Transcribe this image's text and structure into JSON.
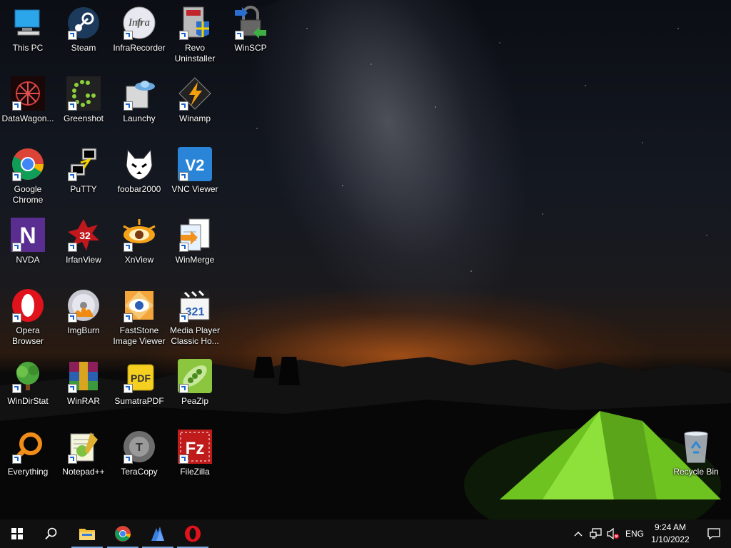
{
  "desktop_icons": [
    {
      "id": "this-pc",
      "label": "This PC",
      "icon": "computer-icon"
    },
    {
      "id": "steam",
      "label": "Steam",
      "icon": "steam-icon"
    },
    {
      "id": "infrarecorder",
      "label": "InfraRecorder",
      "icon": "infrarecorder-icon",
      "icon_text": "Infra"
    },
    {
      "id": "revo",
      "label": "Revo\nUninstaller",
      "icon": "revo-uninstaller-icon"
    },
    {
      "id": "winscp",
      "label": "WinSCP",
      "icon": "winscp-icon"
    },
    {
      "id": "datawagon",
      "label": "DataWagon...",
      "icon": "datawagon-icon"
    },
    {
      "id": "greenshot",
      "label": "Greenshot",
      "icon": "greenshot-icon"
    },
    {
      "id": "launchy",
      "label": "Launchy",
      "icon": "launchy-icon"
    },
    {
      "id": "winamp",
      "label": "Winamp",
      "icon": "winamp-icon"
    },
    {
      "id": "chrome",
      "label": "Google\nChrome",
      "icon": "chrome-icon"
    },
    {
      "id": "putty",
      "label": "PuTTY",
      "icon": "putty-icon"
    },
    {
      "id": "foobar",
      "label": "foobar2000",
      "icon": "foobar-icon"
    },
    {
      "id": "vnc",
      "label": "VNC Viewer",
      "icon": "vnc-icon",
      "icon_text": "V2"
    },
    {
      "id": "nvda",
      "label": "NVDA",
      "icon": "nvda-icon",
      "icon_text": "N"
    },
    {
      "id": "irfanview",
      "label": "IrfanView",
      "icon": "irfanview-icon",
      "icon_text": "32"
    },
    {
      "id": "xnview",
      "label": "XnView",
      "icon": "xnview-icon"
    },
    {
      "id": "winmerge",
      "label": "WinMerge",
      "icon": "winmerge-icon"
    },
    {
      "id": "opera",
      "label": "Opera\nBrowser",
      "icon": "opera-icon"
    },
    {
      "id": "imgburn",
      "label": "ImgBurn",
      "icon": "imgburn-icon"
    },
    {
      "id": "faststone",
      "label": "FastStone\nImage Viewer",
      "icon": "faststone-icon"
    },
    {
      "id": "mpc",
      "label": "Media Player\nClassic Ho...",
      "icon": "mpc-icon",
      "icon_text": "321"
    },
    {
      "id": "windirstat",
      "label": "WinDirStat",
      "icon": "windirstat-icon"
    },
    {
      "id": "winrar",
      "label": "WinRAR",
      "icon": "winrar-icon"
    },
    {
      "id": "sumatra",
      "label": "SumatraPDF",
      "icon": "sumatrapdf-icon",
      "icon_text": "PDF"
    },
    {
      "id": "peazip",
      "label": "PeaZip",
      "icon": "peazip-icon"
    },
    {
      "id": "everything",
      "label": "Everything",
      "icon": "everything-icon"
    },
    {
      "id": "notepadpp",
      "label": "Notepad++",
      "icon": "notepadpp-icon"
    },
    {
      "id": "teracopy",
      "label": "TeraCopy",
      "icon": "teracopy-icon",
      "icon_text": "T"
    },
    {
      "id": "filezilla",
      "label": "FileZilla",
      "icon": "filezilla-icon",
      "icon_text": "Fz"
    }
  ],
  "recycle_bin": {
    "label": "Recycle Bin",
    "icon": "recycle-bin-icon"
  },
  "taskbar": {
    "pinned": [
      {
        "id": "file-explorer",
        "icon": "folder-icon"
      },
      {
        "id": "chrome",
        "icon": "chrome-icon"
      },
      {
        "id": "app-blue",
        "icon": "blue-app-icon"
      },
      {
        "id": "opera",
        "icon": "opera-icon"
      }
    ],
    "tray": {
      "language": "ENG",
      "time": "9:24 AM",
      "date": "1/10/2022"
    }
  }
}
